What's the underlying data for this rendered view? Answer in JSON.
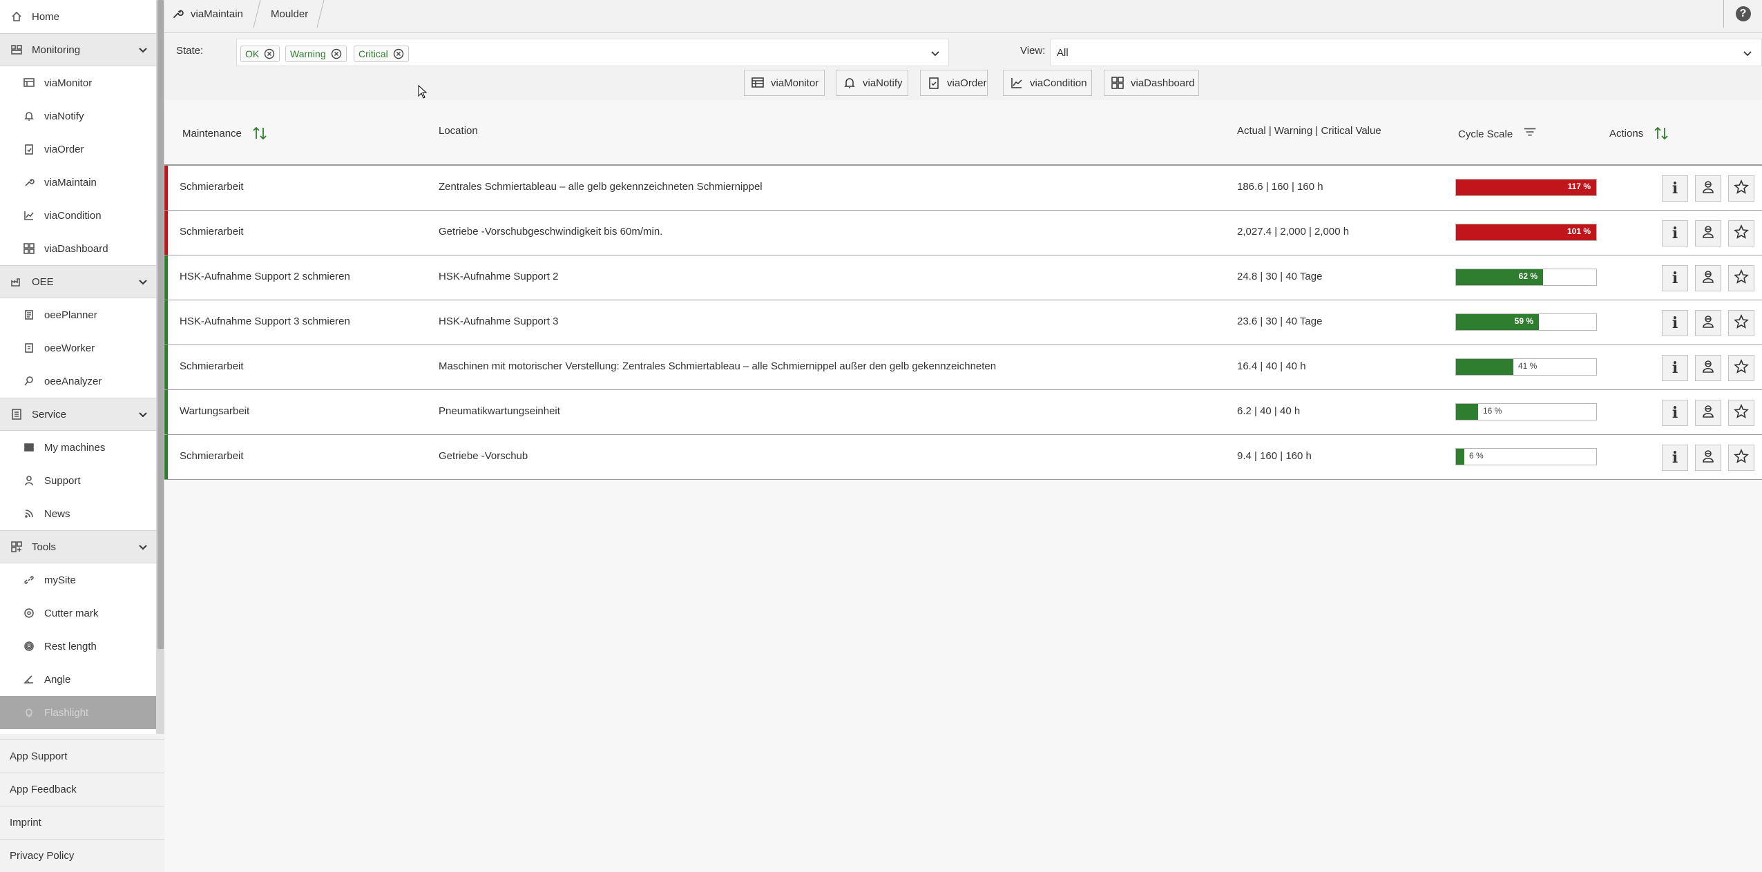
{
  "nav": {
    "home": "Home",
    "monitoring": {
      "label": "Monitoring",
      "items": [
        "viaMonitor",
        "viaNotify",
        "viaOrder",
        "viaMaintain",
        "viaCondition",
        "viaDashboard"
      ]
    },
    "oee": {
      "label": "OEE",
      "items": [
        "oeePlanner",
        "oeeWorker",
        "oeeAnalyzer"
      ]
    },
    "service": {
      "label": "Service",
      "items": [
        "My machines",
        "Support",
        "News"
      ]
    },
    "tools": {
      "label": "Tools",
      "items": [
        "mySite",
        "Cutter mark",
        "Rest length",
        "Angle",
        "Flashlight"
      ]
    },
    "footer": [
      "App Support",
      "App Feedback",
      "Imprint",
      "Privacy Policy"
    ]
  },
  "breadcrumb": {
    "app": "viaMaintain",
    "machine": "Moulder"
  },
  "filters": {
    "state_label": "State:",
    "state_chips": [
      "OK",
      "Warning",
      "Critical"
    ],
    "view_label": "View:",
    "view_value": "All"
  },
  "app_buttons": [
    "viaMonitor",
    "viaNotify",
    "viaOrder",
    "viaCondition",
    "viaDashboard"
  ],
  "table": {
    "headers": {
      "maintenance": "Maintenance",
      "location": "Location",
      "values": "Actual | Warning | Critical Value",
      "cycle": "Cycle Scale",
      "actions": "Actions"
    },
    "rows": [
      {
        "maintenance": "Schmierarbeit",
        "location": "Zentrales Schmiertableau – alle gelb gekennzeichneten Schmiernippel",
        "values": "186.6 | 160 | 160 h",
        "percent": 117,
        "percent_label": "117 %",
        "status": "critical"
      },
      {
        "maintenance": "Schmierarbeit",
        "location": "Getriebe -Vorschubgeschwindigkeit bis 60m/min.",
        "values": "2,027.4 | 2,000 | 2,000 h",
        "percent": 101,
        "percent_label": "101 %",
        "status": "critical"
      },
      {
        "maintenance": "HSK-Aufnahme Support 2 schmieren",
        "location": "HSK-Aufnahme Support 2",
        "values": "24.8 | 30 | 40 Tage",
        "percent": 62,
        "percent_label": "62 %",
        "status": "ok"
      },
      {
        "maintenance": "HSK-Aufnahme Support 3 schmieren",
        "location": "HSK-Aufnahme Support 3",
        "values": "23.6 | 30 | 40 Tage",
        "percent": 59,
        "percent_label": "59 %",
        "status": "ok"
      },
      {
        "maintenance": "Schmierarbeit",
        "location": "Maschinen mit motorischer Verstellung: Zentrales Schmiertableau – alle Schmiernippel außer den gelb gekennzeichneten",
        "values": "16.4 | 40 | 40 h",
        "percent": 41,
        "percent_label": "41 %",
        "status": "ok"
      },
      {
        "maintenance": "Wartungsarbeit",
        "location": "Pneumatikwartungseinheit",
        "values": "6.2 | 40 | 40 h",
        "percent": 16,
        "percent_label": "16 %",
        "status": "ok"
      },
      {
        "maintenance": "Schmierarbeit",
        "location": "Getriebe -Vorschub",
        "values": "9.4 | 160 | 160 h",
        "percent": 6,
        "percent_label": "6 %",
        "status": "ok"
      }
    ]
  },
  "colors": {
    "critical": "#c0151b",
    "ok": "#2f7d2f",
    "accent_green": "#2f7d2f"
  }
}
